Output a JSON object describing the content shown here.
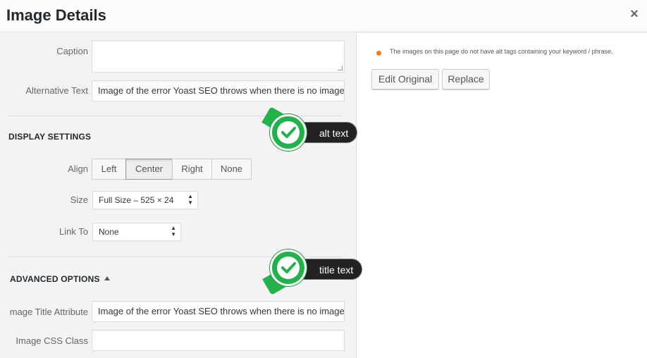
{
  "header": {
    "title": "Image Details",
    "close_glyph": "×"
  },
  "fields": {
    "caption_label": "Caption",
    "alt_label": "Alternative Text",
    "alt_value": "Image of the error Yoast SEO throws when there is no image w",
    "title_attr_label": "mage Title Attribute",
    "title_attr_value": "Image of the error Yoast SEO throws when there is no image w",
    "css_class_label": "Image CSS Class",
    "css_class_value": ""
  },
  "display_settings": {
    "heading": "DISPLAY SETTINGS",
    "align_label": "Align",
    "align_options": [
      "Left",
      "Center",
      "Right",
      "None"
    ],
    "align_selected": "Center",
    "size_label": "Size",
    "size_value": "Full Size – 525 × 24",
    "link_label": "Link To",
    "link_value": "None"
  },
  "advanced": {
    "heading": "ADVANCED OPTIONS"
  },
  "right_panel": {
    "notice": "The images on this page do not have alt tags containing your keyword / phrase.",
    "edit_original": "Edit Original",
    "replace": "Replace",
    "notice_color": "#ee7c1b"
  },
  "callouts": {
    "alt": "alt text",
    "title": "title text",
    "badge_color": "#22b24c"
  },
  "icons": {
    "close": "close-icon",
    "check": "checkmark-icon",
    "select_arrows": "select-arrows-icon",
    "collapse": "triangle-up-icon",
    "notice_dot": "status-dot-icon"
  }
}
